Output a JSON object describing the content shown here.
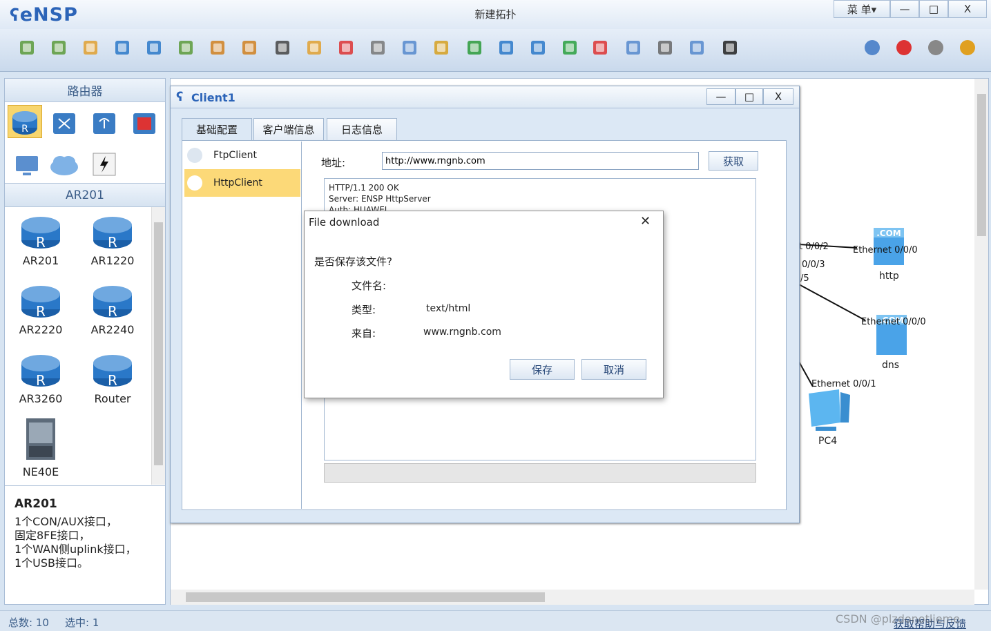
{
  "app": {
    "logo": "eNSP",
    "title": "新建拓扑",
    "menu_label": "菜 单▾",
    "minimize": "—",
    "maximize": "□",
    "close": "X"
  },
  "toolbar": {
    "icons": [
      "new-topology-icon",
      "new-lab-icon",
      "open-icon",
      "save-icon",
      "save-as-icon",
      "print-icon",
      "undo-icon",
      "redo-icon",
      "select-icon",
      "pan-icon",
      "delete-icon",
      "delete-link-icon",
      "text-icon",
      "rectangle-icon",
      "zoom-in-icon",
      "zoom-out-icon",
      "fit-icon",
      "start-icon",
      "stop-icon",
      "capture-icon",
      "topology-icon",
      "grid-icon",
      "cli-icon"
    ],
    "right_icons": [
      "feedback-icon",
      "huawei-icon",
      "settings-icon",
      "help-icon"
    ]
  },
  "left_panel": {
    "category_title": "路由器",
    "subcategory": "AR201",
    "devices": [
      {
        "name": "AR201"
      },
      {
        "name": "AR1220"
      },
      {
        "name": "AR2220"
      },
      {
        "name": "AR2240"
      },
      {
        "name": "AR3260"
      },
      {
        "name": "Router"
      },
      {
        "name": "NE40E"
      }
    ],
    "info_title": "AR201",
    "info_lines": [
      "1个CON/AUX接口，",
      "固定8FE接口，",
      "1个WAN侧uplink接口，",
      "1个USB接口。"
    ]
  },
  "canvas": {
    "labels": {
      "g002": "t 0/0/2",
      "g003": "0/0/3",
      "g005": "/5",
      "http_port": "Ethernet 0/0/0",
      "http_name": "http",
      "dns_port": "Ethernet 0/0/0",
      "dns_name": "dns",
      "pc_port": "Ethernet 0/0/1",
      "pc_name": "PC4"
    }
  },
  "client": {
    "title": "Client1",
    "minimize": "—",
    "maximize": "□",
    "close": "X",
    "tabs": [
      "基础配置",
      "客户端信息",
      "日志信息"
    ],
    "list": [
      {
        "label": "FtpClient",
        "selected": false
      },
      {
        "label": "HttpClient",
        "selected": true
      }
    ],
    "address_label": "地址:",
    "address_value": "http://www.rngnb.com",
    "fetch_button": "获取",
    "response_lines": [
      "HTTP/1.1 200 OK",
      "Server: ENSP HttpServer",
      "Auth: HUAWEI"
    ]
  },
  "dialog": {
    "title": "File download",
    "close": "✕",
    "question": "是否保存该文件?",
    "filename_label": "文件名:",
    "filename_value": "",
    "type_label": "类型:",
    "type_value": "text/html",
    "from_label": "来自:",
    "from_value": "www.rngnb.com",
    "save_button": "保存",
    "cancel_button": "取消"
  },
  "status": {
    "total_label": "总数: 10",
    "selected_label": "选中: 1",
    "help_link": "获取帮助与反馈",
    "watermark": "CSDN @plzdonotlieme"
  }
}
